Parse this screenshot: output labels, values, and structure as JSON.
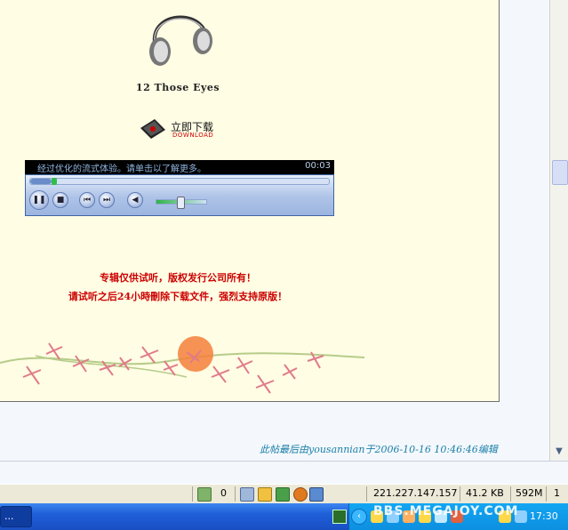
{
  "post": {
    "track_title": "12 Those Eyes",
    "download": {
      "label_cn": "立即下载",
      "label_en": "DOWNLOAD"
    },
    "player": {
      "message": "经过优化的流式体验。请单击以了解更多。",
      "time": "00:03",
      "progress_fraction": 0.07,
      "volume_fraction": 0.48
    },
    "notice": {
      "line1": "专辑仅供试听，版权发行公司所有！",
      "line2": "请试听之后24小時刪除下载文件，强烈支持原版！"
    }
  },
  "edit_note": "此帖最后由yousannian于2006-10-16 10:46:46编辑",
  "statusbar": {
    "counter": "0",
    "ip": "221.227.147.157",
    "size": "41.2 KB",
    "memory": "592M",
    "page": "1"
  },
  "taskbar": {
    "task_label": "...",
    "watermark": "BBS.MEGAJOY.COM",
    "clock": "17:30"
  },
  "colors": {
    "page_bg": "#fffde4",
    "notice_red": "#cc0000",
    "edit_note_blue": "#1a7fa8",
    "taskbar_blue": "#1f5fd8",
    "tray_blue": "#0d8fe0"
  },
  "icons": [
    "headphones-icon",
    "download-icon",
    "play-pause-icon",
    "stop-icon",
    "prev-icon",
    "next-icon",
    "mute-icon",
    "recycle-icon",
    "network-icon",
    "refresh-icon",
    "gear-icon",
    "window-icon",
    "language-icon",
    "chevron-left-icon"
  ]
}
